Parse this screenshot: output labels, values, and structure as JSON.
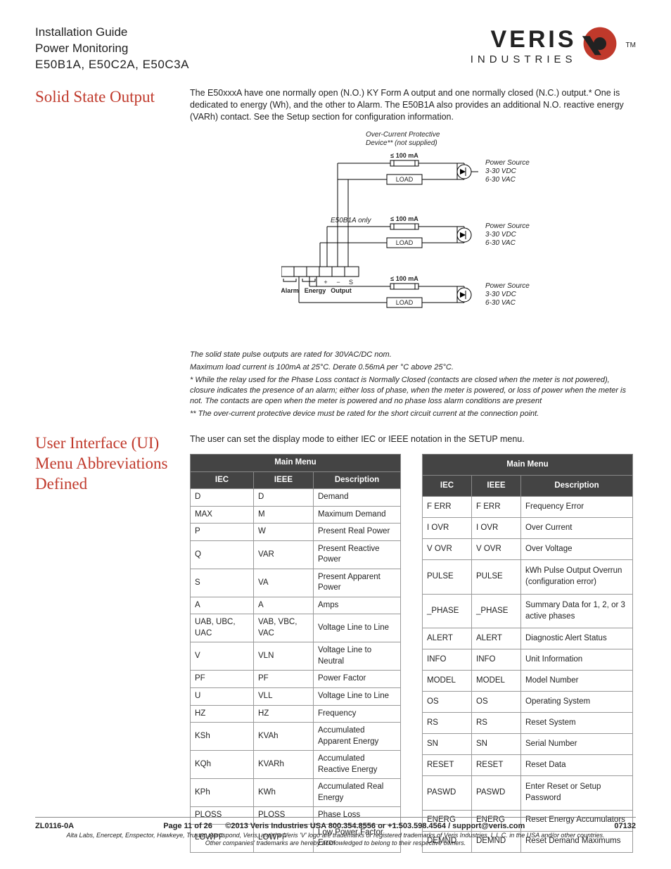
{
  "header": {
    "line1": "Installation Guide",
    "line2": "Power Monitoring",
    "models": "E50B1A, E50C2A, E50C3A",
    "logo_main": "VERIS",
    "logo_sub": "INDUSTRIES",
    "tm": "TM"
  },
  "solid_state": {
    "title": "Solid State Output",
    "para": "The E50xxxA have one normally open (N.O.) KY Form A output and one normally closed (N.C.) output.* One is dedicated to energy (Wh), and the other to Alarm. The E50B1A also provides an additional N.O. reactive energy (VARh) contact. See the Setup section for configuration information.",
    "diagram": {
      "ocp_label": "Over-Current Protective\nDevice** (not supplied)",
      "limit": "≤ 100 mA",
      "load": "LOAD",
      "power_src_l1": "Power Source",
      "power_src_l2": "3-30 VDC",
      "power_src_l3": "6-30 VAC",
      "e50b1a_only": "E50B1A only",
      "alarm": "Alarm",
      "energy": "Energy",
      "output": "Output",
      "plus": "+",
      "minus": "−",
      "s": "S"
    },
    "notes": {
      "n1": "The solid state pulse outputs are rated for 30VAC/DC nom.",
      "n2": "Maximum load current is 100mA at 25°C. Derate 0.56mA per °C above 25°C.",
      "n3": "* While the relay used for the Phase Loss contact is Normally Closed (contacts are closed when the meter is not powered), closure indicates the presence of an alarm; either loss of phase, when the meter is powered, or loss of power when the meter is not. The contacts are open when the meter is powered and no phase loss alarm conditions are present",
      "n4": "** The over-current protective device must be rated for the short circuit current at the connection point."
    }
  },
  "ui_abbr": {
    "title": "User Interface (UI) Menu Abbreviations Defined",
    "intro": "The user can set the display mode to either IEC or IEEE notation in the SETUP menu.",
    "table_header": "Main Menu",
    "cols": {
      "iec": "IEC",
      "ieee": "IEEE",
      "desc": "Description"
    },
    "t1": [
      {
        "iec": "D",
        "ieee": "D",
        "desc": "Demand"
      },
      {
        "iec": "MAX",
        "ieee": "M",
        "desc": "Maximum Demand"
      },
      {
        "iec": "P",
        "ieee": "W",
        "desc": "Present Real Power"
      },
      {
        "iec": "Q",
        "ieee": "VAR",
        "desc": "Present Reactive Power"
      },
      {
        "iec": "S",
        "ieee": "VA",
        "desc": "Present Apparent Power"
      },
      {
        "iec": "A",
        "ieee": "A",
        "desc": "Amps"
      },
      {
        "iec": "UAB, UBC, UAC",
        "ieee": "VAB, VBC, VAC",
        "desc": "Voltage Line to Line"
      },
      {
        "iec": "V",
        "ieee": "VLN",
        "desc": "Voltage Line to Neutral"
      },
      {
        "iec": "PF",
        "ieee": "PF",
        "desc": "Power Factor"
      },
      {
        "iec": "U",
        "ieee": "VLL",
        "desc": "Voltage Line to Line"
      },
      {
        "iec": "HZ",
        "ieee": "HZ",
        "desc": "Frequency"
      },
      {
        "iec": "KSh",
        "ieee": "KVAh",
        "desc": "Accumulated Apparent Energy"
      },
      {
        "iec": "KQh",
        "ieee": "KVARh",
        "desc": "Accumulated Reactive Energy"
      },
      {
        "iec": "KPh",
        "ieee": "KWh",
        "desc": "Accumulated Real Energy"
      },
      {
        "iec": "PLOSS",
        "ieee": "PLOSS",
        "desc": "Phase Loss"
      },
      {
        "iec": "LOWPF",
        "ieee": "LOWPF",
        "desc": "Low Power Factor Error"
      }
    ],
    "t2": [
      {
        "iec": "F ERR",
        "ieee": "F ERR",
        "desc": "Frequency Error"
      },
      {
        "iec": "I OVR",
        "ieee": "I OVR",
        "desc": "Over Current"
      },
      {
        "iec": "V OVR",
        "ieee": "V OVR",
        "desc": "Over Voltage"
      },
      {
        "iec": "PULSE",
        "ieee": "PULSE",
        "desc": "kWh Pulse Output Overrun (configuration error)"
      },
      {
        "iec": "_PHASE",
        "ieee": "_PHASE",
        "desc": "Summary Data for 1, 2, or 3 active phases"
      },
      {
        "iec": "ALERT",
        "ieee": "ALERT",
        "desc": "Diagnostic Alert Status"
      },
      {
        "iec": "INFO",
        "ieee": "INFO",
        "desc": "Unit Information"
      },
      {
        "iec": "MODEL",
        "ieee": "MODEL",
        "desc": "Model Number"
      },
      {
        "iec": "OS",
        "ieee": "OS",
        "desc": "Operating System"
      },
      {
        "iec": "RS",
        "ieee": "RS",
        "desc": "Reset System"
      },
      {
        "iec": "SN",
        "ieee": "SN",
        "desc": "Serial Number"
      },
      {
        "iec": "RESET",
        "ieee": "RESET",
        "desc": "Reset Data"
      },
      {
        "iec": "PASWD",
        "ieee": "PASWD",
        "desc": "Enter Reset or Setup Password"
      },
      {
        "iec": "ENERG",
        "ieee": "ENERG",
        "desc": "Reset Energy Accumulators"
      },
      {
        "iec": "DEMND",
        "ieee": "DEMND",
        "desc": "Reset Demand Maximums"
      }
    ]
  },
  "footer": {
    "doc": "ZL0116-0A",
    "page": "Page 11 of 26",
    "copyright": "©2013 Veris Industries  USA 800.354.8556 or +1.503.598.4564  /  support@veris.com",
    "rev": "07132",
    "fine1": "Alta Labs, Enercept, Enspector, Hawkeye, Trustat, Aerospond, Veris, and the Veris 'V' logo are trademarks or registered trademarks of  Veris Industries, L.L.C. in the USA and/or other countries.",
    "fine2": "Other companies' trademarks are hereby acknowledged to belong to their respective owners."
  }
}
